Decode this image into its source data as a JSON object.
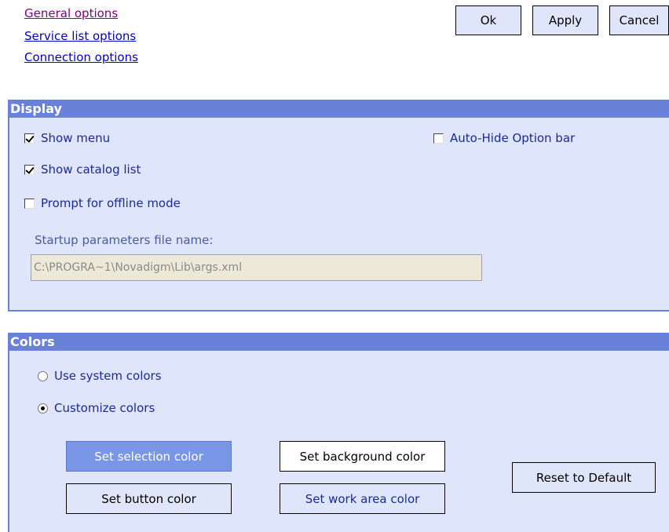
{
  "nav": {
    "general": "General options",
    "service": "Service list options",
    "connection": "Connection options"
  },
  "actions": {
    "ok": "Ok",
    "apply": "Apply",
    "cancel": "Cancel"
  },
  "display": {
    "title": "Display",
    "show_menu": {
      "label": "Show menu",
      "checked": true
    },
    "show_catalog": {
      "label": "Show catalog list",
      "checked": true
    },
    "prompt_offline": {
      "label": "Prompt for offline mode",
      "checked": false
    },
    "auto_hide": {
      "label": "Auto-Hide Option bar",
      "checked": false
    },
    "startup_label": "Startup parameters file name:",
    "startup_value": "C:\\PROGRA~1\\Novadigm\\Lib\\args.xml"
  },
  "colors": {
    "title": "Colors",
    "use_system": {
      "label": "Use system colors",
      "selected": false
    },
    "customize": {
      "label": "Customize colors",
      "selected": true
    },
    "set_selection": "Set selection color",
    "set_background": "Set background color",
    "set_button": "Set button color",
    "set_work_area": "Set work area color",
    "reset_default": "Reset to Default"
  },
  "palette": {
    "link_visited": "#800080",
    "link": "#0000ee",
    "header": "#6a81d9",
    "panel": "#dfe5fa",
    "selection": "#7a96e6"
  }
}
